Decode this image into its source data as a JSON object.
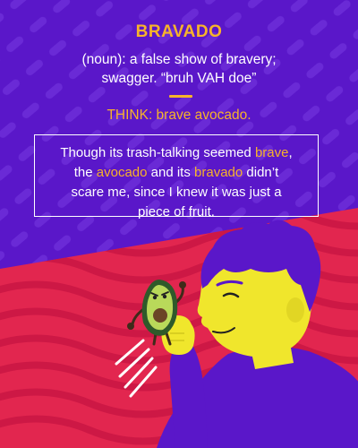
{
  "word": "BRAVADO",
  "definition_line1": "(noun): a false show of bravery;",
  "definition_line2": "swagger. “bruh VAH doe”",
  "think": "THINK: brave avocado.",
  "example": {
    "l1_pre": "Though its trash-talking seemed ",
    "l1_hl": "brave",
    "l1_post": ",",
    "l2_pre": "the ",
    "l2_hl1": "avocado",
    "l2_mid": " and its ",
    "l2_hl2": "bravado",
    "l2_post": " didn’t",
    "l3": "scare me, since I knew it was just a",
    "l4": "piece of fruit."
  },
  "colors": {
    "purple": "#5a17c9",
    "accent": "#f7b32b",
    "red": "#e2264f",
    "skin": "#f0e62c",
    "hair": "#5a17c9",
    "shirt": "#5a17c9"
  },
  "icons": {
    "illustration": "man-holding-angry-avocado-illustration"
  }
}
